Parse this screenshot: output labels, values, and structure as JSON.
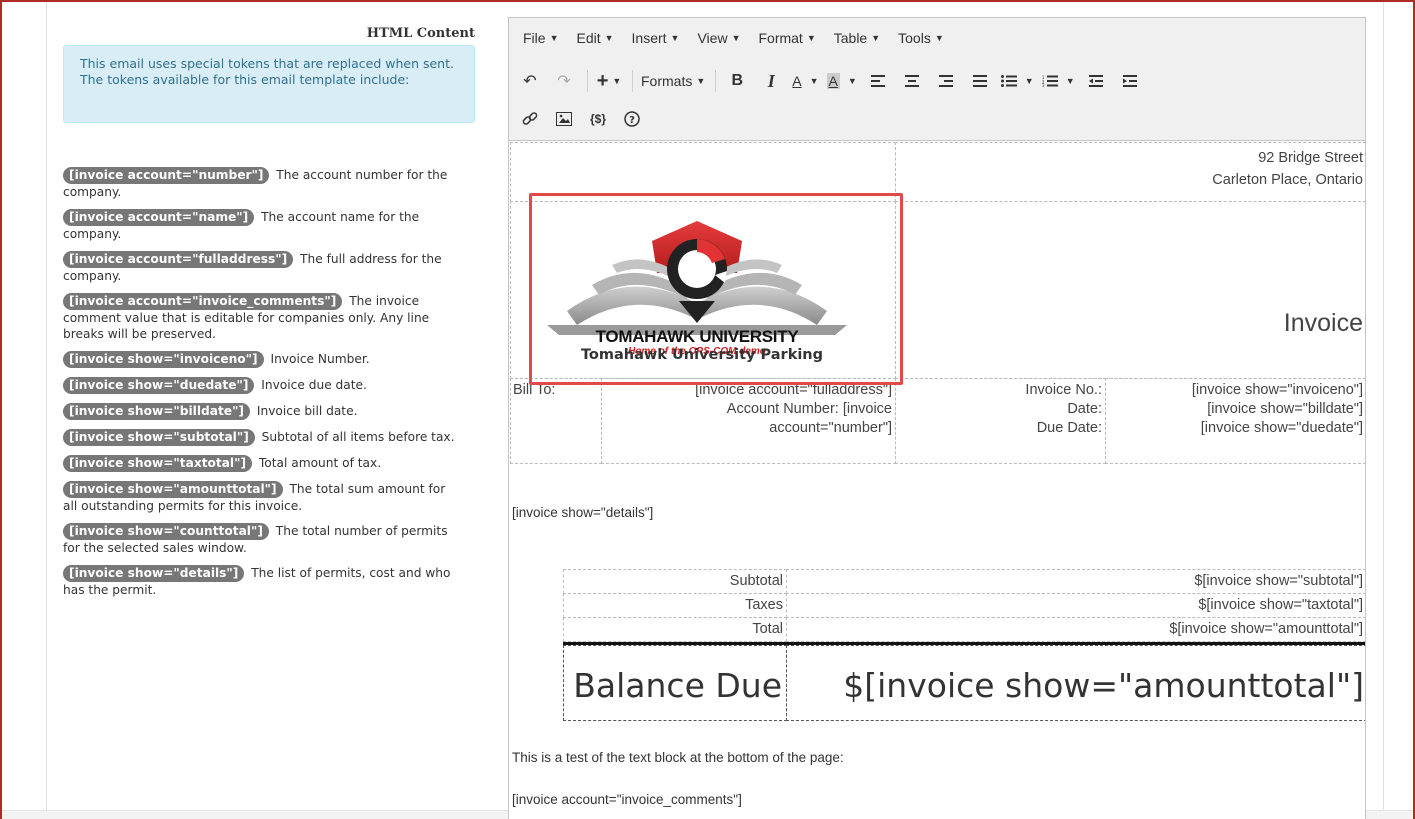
{
  "left_panel": {
    "heading": "HTML Content",
    "info_text": "This email uses special tokens that are replaced when sent. The tokens available for this email template include:",
    "tokens": [
      {
        "token": "[invoice account=\"number\"]",
        "desc": "The account number for the company."
      },
      {
        "token": "[invoice account=\"name\"]",
        "desc": "The account name for the company."
      },
      {
        "token": "[invoice account=\"fulladdress\"]",
        "desc": "The full address for the company."
      },
      {
        "token": "[invoice account=\"invoice_comments\"]",
        "desc": "The invoice comment value that is editable for companies only. Any line breaks will be preserved."
      },
      {
        "token": "[invoice show=\"invoiceno\"]",
        "desc": "Invoice Number."
      },
      {
        "token": "[invoice show=\"duedate\"]",
        "desc": "Invoice due date."
      },
      {
        "token": "[invoice show=\"billdate\"]",
        "desc": "Invoice bill date."
      },
      {
        "token": "[invoice show=\"subtotal\"]",
        "desc": "Subtotal of all items before tax."
      },
      {
        "token": "[invoice show=\"taxtotal\"]",
        "desc": "Total amount of tax."
      },
      {
        "token": "[invoice show=\"amounttotal\"]",
        "desc": "The total sum amount for all outstanding permits for this invoice."
      },
      {
        "token": "[invoice show=\"counttotal\"]",
        "desc": "The total number of permits for the selected sales window."
      },
      {
        "token": "[invoice show=\"details\"]",
        "desc": "The list of permits, cost and who has the permit."
      }
    ]
  },
  "menubar": [
    "File",
    "Edit",
    "Insert",
    "View",
    "Format",
    "Table",
    "Tools"
  ],
  "toolbar": {
    "formats_label": "Formats",
    "icons": [
      "undo-icon",
      "redo-icon",
      "insert-plus-icon",
      "bold-icon",
      "italic-icon",
      "text-color-icon",
      "background-color-icon",
      "align-left-icon",
      "align-center-icon",
      "align-right-icon",
      "align-justify-icon",
      "bullet-list-icon",
      "numbered-list-icon",
      "outdent-icon",
      "indent-icon",
      "link-icon",
      "image-icon",
      "token-icon",
      "help-icon"
    ]
  },
  "doc": {
    "address_line1": "92 Bridge Street",
    "address_line2": "Carleton Place, Ontario",
    "invoice_title": "Invoice",
    "logo_university": "TOMAHAWK UNIVERSITY",
    "logo_tagline": "Home of the OPS-COM demo",
    "logo_parking": "Tomahawk University Parking",
    "bill_to_label": "Bill To:",
    "bill_to_value": "[invoice account=\"fulladdress\"]",
    "account_number_line1": "Account Number: [invoice",
    "account_number_line2": "account=\"number\"]",
    "invoice_no_label": "Invoice No.:",
    "date_label": "Date:",
    "due_date_label": "Due Date:",
    "invoice_no_value": "[invoice show=\"invoiceno\"]",
    "date_value": "[invoice show=\"billdate\"]",
    "due_date_value": "[invoice show=\"duedate\"]",
    "details_token": "[invoice show=\"details\"]",
    "subtotal_label": "Subtotal",
    "subtotal_value": "$[invoice show=\"subtotal\"]",
    "taxes_label": "Taxes",
    "taxes_value": "$[invoice show=\"taxtotal\"]",
    "total_label": "Total",
    "total_value": "$[invoice show=\"amounttotal\"]",
    "balance_label": "Balance Due",
    "balance_value": "$[invoice show=\"amounttotal\"]",
    "footer_text": "This is a test of the text block at the bottom of the page:",
    "comments_token": "[invoice account=\"invoice_comments\"]"
  },
  "colors": {
    "frame": "#b02a2a",
    "highlight": "#e04a4a",
    "badge": "#777777",
    "info_bg": "#d9edf7"
  }
}
